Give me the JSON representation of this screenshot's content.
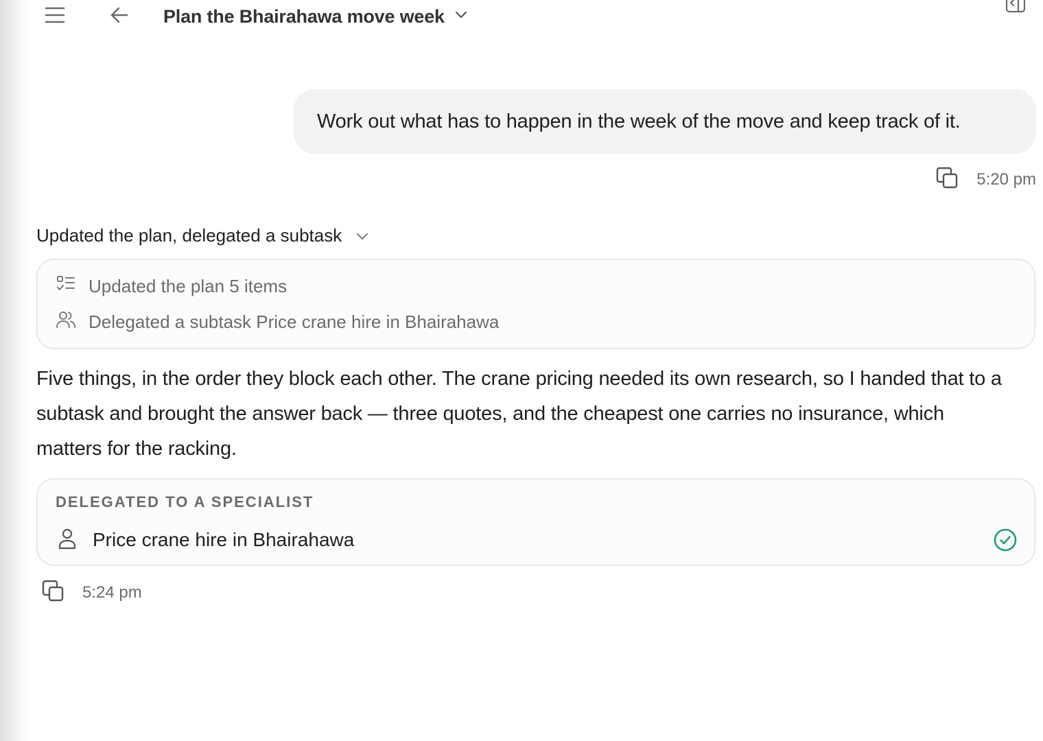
{
  "header": {
    "title": "Plan the Bhairahawa move week",
    "icons": {
      "menu": "hamburger-menu-icon",
      "back": "arrow-left-icon",
      "title_dropdown": "chevron-down-icon",
      "panel": "sidebar-panel-icon"
    }
  },
  "user_message": {
    "text": "Work out what has to happen in the week of the move and keep track of it.",
    "time": "5:20 pm",
    "copy_icon": "copy-icon"
  },
  "activity": {
    "summary": "Updated the plan, delegated a subtask",
    "items": [
      {
        "icon": "checklist-icon",
        "text": "Updated the plan 5 items"
      },
      {
        "icon": "people-icon",
        "text": "Delegated a subtask Price crane hire in Bhairahawa"
      }
    ]
  },
  "assistant_message": {
    "text": "Five things, in the order they block each other. The crane pricing needed its own research, so I handed that to a subtask and brought the answer back — three quotes, and the cheapest one carries no insurance, which matters for the racking.",
    "time": "5:24 pm",
    "copy_icon": "copy-icon"
  },
  "delegation": {
    "heading": "DELEGATED TO A SPECIALIST",
    "item": {
      "label": "Price crane hire in Bhairahawa",
      "icon": "person-icon",
      "status": "completed",
      "status_icon": "check-circle-icon"
    }
  },
  "colors": {
    "bubble_bg": "#f2f2f3",
    "card_border": "#e8e8e8",
    "muted_text": "#6b6b6b",
    "success_green": "#1f9e6a"
  }
}
